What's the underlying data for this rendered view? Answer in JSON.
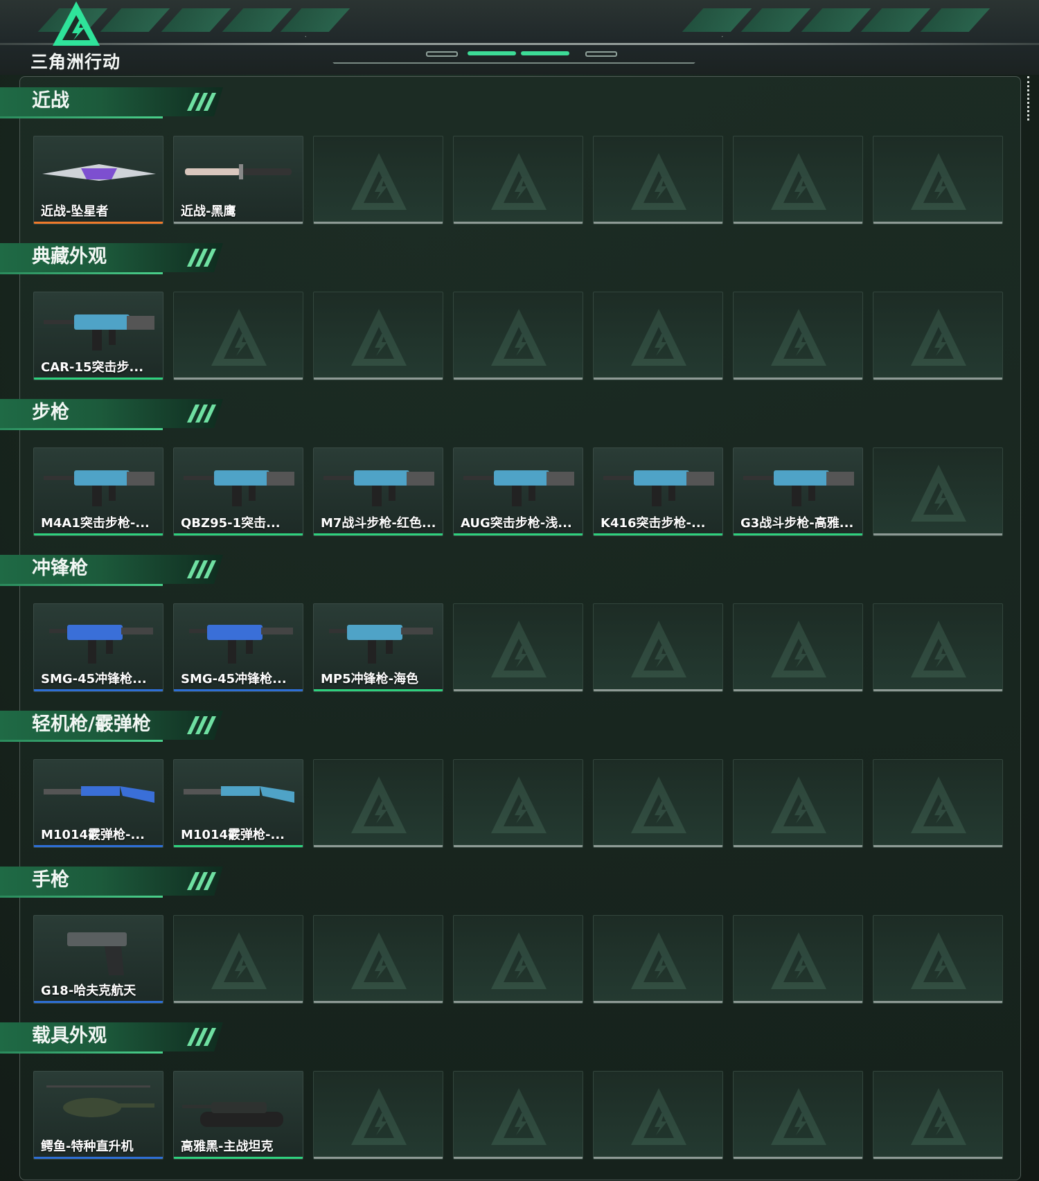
{
  "header": {
    "logo_text": "三角洲行动"
  },
  "colors": {
    "accent": "#3ddc97",
    "rarity_orange": "#f07a2a",
    "rarity_green": "#2fd17e",
    "rarity_blue": "#2e6fd6",
    "empty_slot": "#8e9a95"
  },
  "sections": [
    {
      "title": "近战",
      "items": [
        {
          "label": "近战-坠星者",
          "rarity": "orange",
          "icon": "melee-blade-icon"
        },
        {
          "label": "近战-黑鹰",
          "rarity": "gray",
          "icon": "knife-icon"
        }
      ]
    },
    {
      "title": "典藏外观",
      "items": [
        {
          "label": "CAR-15突击步...",
          "rarity": "green",
          "icon": "rifle-icon"
        }
      ]
    },
    {
      "title": "步枪",
      "items": [
        {
          "label": "M4A1突击步枪-...",
          "rarity": "green",
          "icon": "rifle-icon"
        },
        {
          "label": "QBZ95-1突击...",
          "rarity": "green",
          "icon": "rifle-icon"
        },
        {
          "label": "M7战斗步枪-红色...",
          "rarity": "green",
          "icon": "rifle-icon"
        },
        {
          "label": "AUG突击步枪-浅...",
          "rarity": "green",
          "icon": "rifle-icon"
        },
        {
          "label": "K416突击步枪-...",
          "rarity": "green",
          "icon": "rifle-icon"
        },
        {
          "label": "G3战斗步枪-高雅...",
          "rarity": "green",
          "icon": "rifle-icon"
        }
      ]
    },
    {
      "title": "冲锋枪",
      "items": [
        {
          "label": "SMG-45冲锋枪...",
          "rarity": "blue",
          "icon": "smg-icon"
        },
        {
          "label": "SMG-45冲锋枪...",
          "rarity": "blue",
          "icon": "smg-icon"
        },
        {
          "label": "MP5冲锋枪-海色",
          "rarity": "green",
          "icon": "smg-icon"
        }
      ]
    },
    {
      "title": "轻机枪/霰弹枪",
      "items": [
        {
          "label": "M1014霰弹枪-...",
          "rarity": "blue",
          "icon": "shotgun-icon"
        },
        {
          "label": "M1014霰弹枪-...",
          "rarity": "green",
          "icon": "shotgun-icon"
        }
      ]
    },
    {
      "title": "手枪",
      "items": [
        {
          "label": "G18-哈夫克航天",
          "rarity": "blue",
          "icon": "pistol-icon"
        }
      ]
    },
    {
      "title": "载具外观",
      "items": [
        {
          "label": "鳄鱼-特种直升机",
          "rarity": "blue",
          "icon": "helicopter-icon"
        },
        {
          "label": "高雅黑-主战坦克",
          "rarity": "green",
          "icon": "tank-icon"
        }
      ]
    }
  ]
}
